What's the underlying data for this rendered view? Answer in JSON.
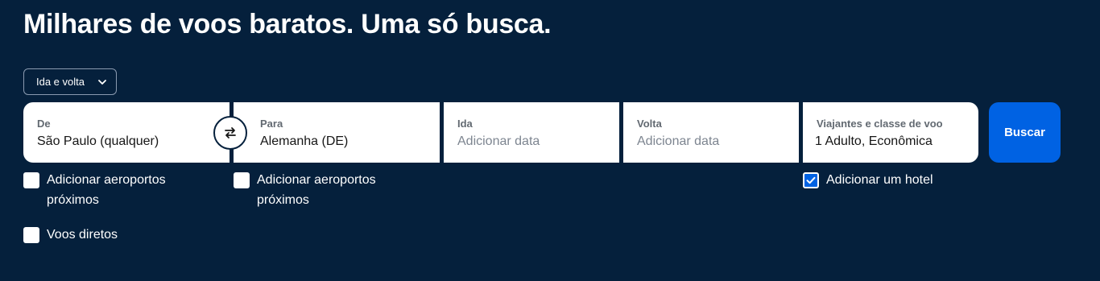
{
  "headline": "Milhares de voos baratos. Uma só busca.",
  "trip_type": {
    "selected": "Ida e volta",
    "icon": "chevron-down-icon"
  },
  "fields": {
    "from": {
      "label": "De",
      "value": "São Paulo (qualquer)"
    },
    "to": {
      "label": "Para",
      "value": "Alemanha (DE)"
    },
    "depart": {
      "label": "Ida",
      "placeholder": "Adicionar data"
    },
    "return": {
      "label": "Volta",
      "placeholder": "Adicionar data"
    },
    "travellers": {
      "label": "Viajantes e classe de voo",
      "value": "1 Adulto, Econômica"
    }
  },
  "swap_icon": "swap-arrows-icon",
  "search_button": "Buscar",
  "options": {
    "nearby_from": {
      "label": "Adicionar aeroportos próximos",
      "checked": false
    },
    "nearby_to": {
      "label": "Adicionar aeroportos próximos",
      "checked": false
    },
    "direct": {
      "label": "Voos diretos",
      "checked": false
    },
    "hotel": {
      "label": "Adicionar um hotel",
      "checked": true
    }
  },
  "colors": {
    "background": "#05203c",
    "accent": "#0062e3",
    "field_bg": "#ffffff"
  }
}
